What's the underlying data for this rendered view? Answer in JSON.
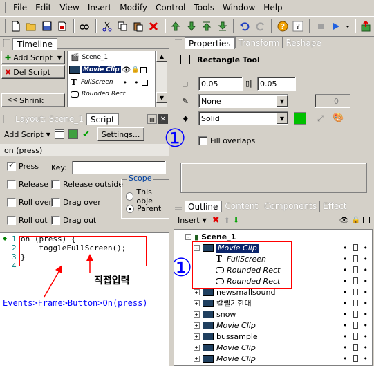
{
  "menu": [
    "File",
    "Edit",
    "View",
    "Insert",
    "Modify",
    "Control",
    "Tools",
    "Window",
    "Help"
  ],
  "timeline": {
    "tab": "Timeline",
    "add_script": "Add Script",
    "del_script": "Del Script",
    "shrink": "Shrink",
    "scene": "Scene_1",
    "rows": [
      "Movie Clip",
      "FullScreen",
      "Rounded Rect"
    ]
  },
  "script_panel": {
    "tab_layout": "Layout: Scene_1",
    "tab_script": "Script",
    "add_script": "Add Script",
    "settings": "Settings...",
    "event_header": "on (press)",
    "press": "Press",
    "key_label": "Key:",
    "release": "Release",
    "release_outside": "Release outside",
    "roll_over": "Roll over",
    "drag_over": "Drag over",
    "roll_out": "Roll out",
    "drag_out": "Drag out",
    "scope_title": "Scope",
    "scope_this": "This obje",
    "scope_parent": "Parent",
    "code_lines": [
      "on (press) {",
      "    toggleFullScreen();",
      "}",
      ""
    ],
    "line_numbers": [
      "1",
      "2",
      "3",
      "4"
    ]
  },
  "annotations": {
    "direct_input": "직접입력",
    "path": "Events>Frame>Button>On(press)",
    "marker": "①"
  },
  "properties": {
    "tab_properties": "Properties",
    "tab_transform": "Transform",
    "tab_reshape": "Reshape",
    "title": "Rectangle Tool",
    "corner_h": "0.05",
    "corner_v": "0.05",
    "line_style": "None",
    "line_width": "0",
    "fill_style": "Solid",
    "fill_overlaps": "Fill overlaps"
  },
  "outline": {
    "tab_outline": "Outline",
    "tab_content": "Content",
    "tab_components": "Components",
    "tab_effect": "Effect",
    "insert": "Insert",
    "scene": "Scene_1",
    "items": [
      {
        "label": "Movie Clip",
        "italic": true,
        "level": 1,
        "expand": "-",
        "icon": "movieclip",
        "selected": true
      },
      {
        "label": "FullScreen",
        "italic": true,
        "level": 2,
        "expand": "",
        "icon": "text"
      },
      {
        "label": "Rounded Rect",
        "italic": true,
        "level": 2,
        "expand": "",
        "icon": "rect"
      },
      {
        "label": "Rounded Rect",
        "italic": true,
        "level": 2,
        "expand": "",
        "icon": "rect"
      },
      {
        "label": "newsmallsound",
        "italic": false,
        "level": 1,
        "expand": "+",
        "icon": "movieclip"
      },
      {
        "label": "칼렐기한대",
        "italic": false,
        "level": 1,
        "expand": "+",
        "icon": "movieclip"
      },
      {
        "label": "snow",
        "italic": false,
        "level": 1,
        "expand": "+",
        "icon": "movieclip"
      },
      {
        "label": "Movie Clip",
        "italic": true,
        "level": 1,
        "expand": "+",
        "icon": "movieclip"
      },
      {
        "label": "bussample",
        "italic": false,
        "level": 1,
        "expand": "+",
        "icon": "movieclip"
      },
      {
        "label": "Movie Clip",
        "italic": true,
        "level": 1,
        "expand": "+",
        "icon": "movieclip"
      },
      {
        "label": "Movie Clip",
        "italic": true,
        "level": 1,
        "expand": "+",
        "icon": "movieclip"
      }
    ]
  },
  "colors": {
    "fill_color": "#00c000",
    "annotation_red": "#ff0000",
    "annotation_blue": "#0000ff",
    "selection": "#0a246a"
  }
}
